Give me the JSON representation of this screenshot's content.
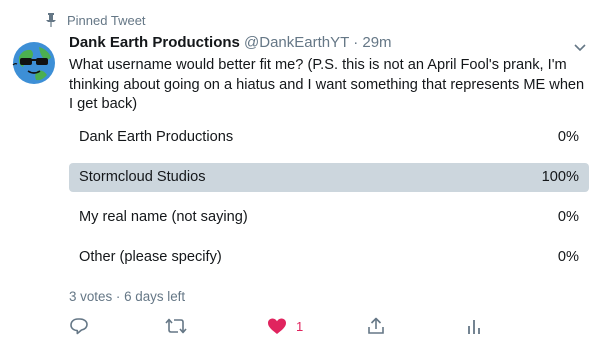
{
  "pinned": {
    "label": "Pinned Tweet",
    "icon": "pin-icon"
  },
  "tweet": {
    "display_name": "Dank Earth Productions",
    "handle": "@DankEarthYT",
    "separator": "·",
    "time": "29m",
    "text": "What username would better fit me? (P.S. this is not an April Fool's prank, I'm thinking about going on a hiatus and I want something that represents ME when I get back)"
  },
  "poll": {
    "options": [
      {
        "label": "Dank Earth Productions",
        "percent": "0%",
        "fraction": 0.0
      },
      {
        "label": "Stormcloud Studios",
        "percent": "100%",
        "fraction": 1.0
      },
      {
        "label": "My real name (not saying)",
        "percent": "0%",
        "fraction": 0.0
      },
      {
        "label": "Other (please specify)",
        "percent": "0%",
        "fraction": 0.0
      }
    ],
    "meta": "3 votes · 6 days left"
  },
  "actions": {
    "like_count": "1",
    "icons": [
      "reply-icon",
      "retweet-icon",
      "like-icon",
      "share-icon",
      "analytics-icon"
    ]
  },
  "colors": {
    "secondary_text": "#657786",
    "poll_bar": "#ccd6dd",
    "like_red": "#e0245e",
    "icon_gray": "#657786"
  }
}
